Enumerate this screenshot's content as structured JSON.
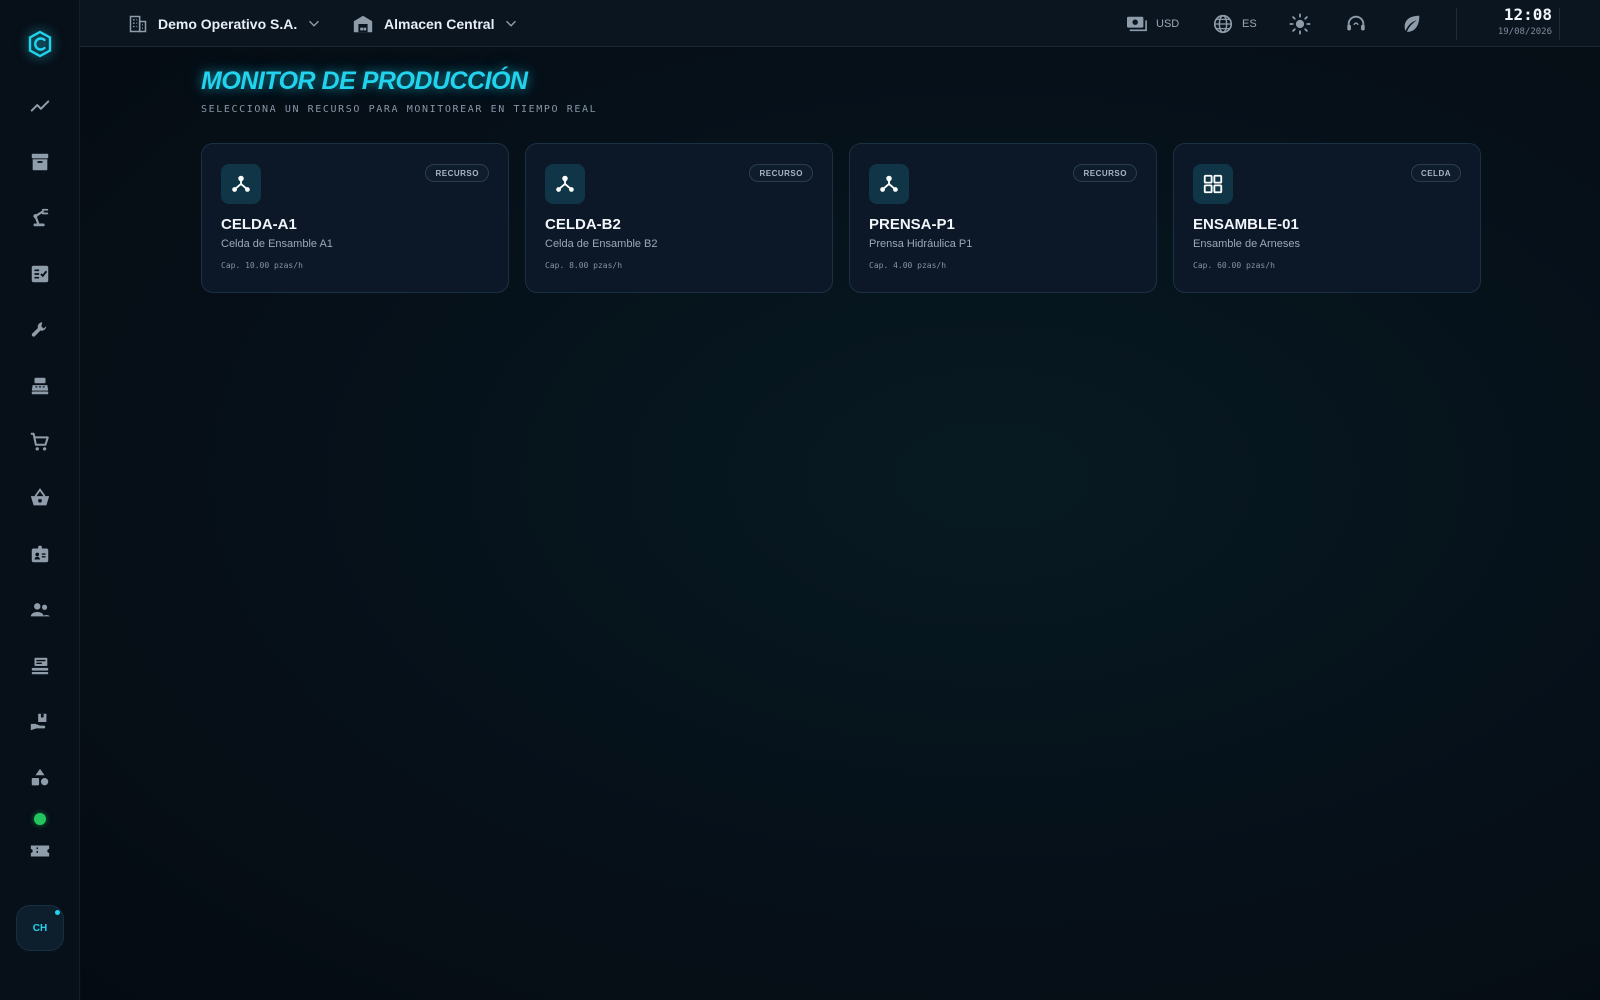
{
  "topbar": {
    "company": "Demo Operativo S.A.",
    "warehouse": "Almacen Central",
    "currency": "USD",
    "language": "ES",
    "time": "12:08",
    "date": "19/08/2026"
  },
  "sidebar": {
    "avatar_initials": "CH",
    "items": [
      {
        "icon": "trending-up-icon"
      },
      {
        "icon": "archive-icon"
      },
      {
        "icon": "robot-arm-icon"
      },
      {
        "icon": "checklist-icon"
      },
      {
        "icon": "wrench-icon"
      },
      {
        "icon": "cash-register-icon"
      },
      {
        "icon": "cart-icon"
      },
      {
        "icon": "basket-icon"
      },
      {
        "icon": "id-badge-icon"
      },
      {
        "icon": "users-icon"
      },
      {
        "icon": "inbox-tray-icon"
      },
      {
        "icon": "hand-boxes-icon"
      },
      {
        "icon": "shapes-icon"
      },
      {
        "icon": "ticket-icon"
      }
    ],
    "status_color": "#22c55e"
  },
  "main": {
    "title": "MONITOR DE PRODUCCIÓN",
    "subtitle": "SELECCIONA UN RECURSO PARA MONITOREAR EN TIEMPO REAL",
    "cards": [
      {
        "badge": "RECURSO",
        "name": "CELDA-A1",
        "description": "Celda de Ensamble A1",
        "capacity": "Cap. 10.00 pzas/h",
        "icon": "network-node-icon"
      },
      {
        "badge": "RECURSO",
        "name": "CELDA-B2",
        "description": "Celda de Ensamble B2",
        "capacity": "Cap. 8.00 pzas/h",
        "icon": "network-node-icon"
      },
      {
        "badge": "RECURSO",
        "name": "PRENSA-P1",
        "description": "Prensa Hidráulica P1",
        "capacity": "Cap. 4.00 pzas/h",
        "icon": "network-node-icon"
      },
      {
        "badge": "CELDA",
        "name": "ENSAMBLE-01",
        "description": "Ensamble de Arneses",
        "capacity": "Cap. 60.00 pzas/h",
        "icon": "grid-icon"
      }
    ]
  },
  "colors": {
    "accent": "#22d3ee",
    "background": "#060d15",
    "card": "#0c1827"
  }
}
